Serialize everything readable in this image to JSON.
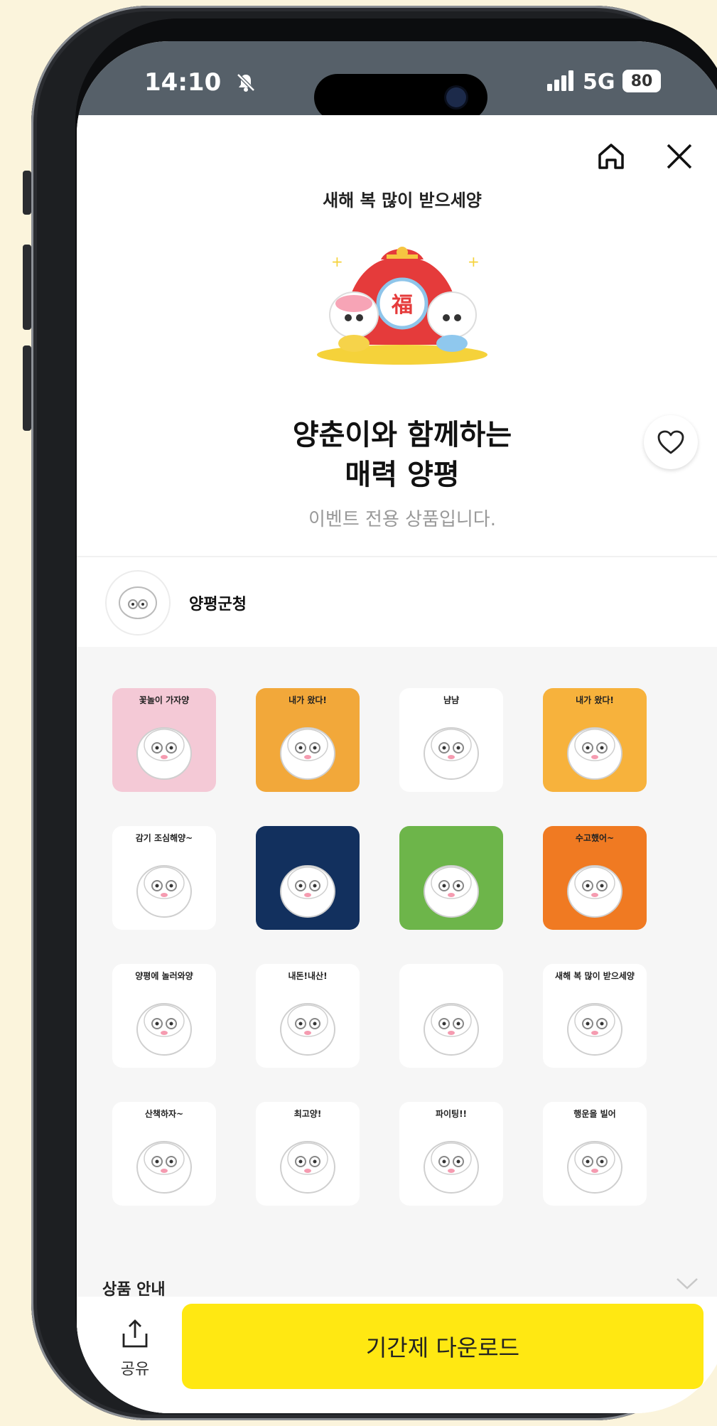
{
  "status_bar": {
    "time": "14:10",
    "network": "5G",
    "battery": "80"
  },
  "hero": {
    "label": "새해 복 많이 받으세양",
    "title_line1": "양춘이와 함께하는",
    "title_line2": "매력 양평",
    "subtitle": "이벤트 전용 상품입니다."
  },
  "author": {
    "name": "양평군청"
  },
  "stickers": [
    {
      "caption": "꽃놀이 가자양",
      "bg": "#f4c9d6"
    },
    {
      "caption": "내가 왔다!",
      "bg": "#f2a83a"
    },
    {
      "caption": "냠냠",
      "bg": "#ffffff"
    },
    {
      "caption": "내가 왔다!",
      "bg": "#f7b23c"
    },
    {
      "caption": "감기 조심해양~",
      "bg": "#ffffff"
    },
    {
      "caption": "",
      "bg": "#12305e"
    },
    {
      "caption": "",
      "bg": "#6db54a"
    },
    {
      "caption": "수고했어~",
      "bg": "#f07a22"
    },
    {
      "caption": "양평에 놀러와양",
      "bg": "#ffffff"
    },
    {
      "caption": "내돈!내산!",
      "bg": "#ffffff"
    },
    {
      "caption": "",
      "bg": "#ffffff"
    },
    {
      "caption": "새해 복 많이 받으세양",
      "bg": "#ffffff"
    },
    {
      "caption": "산책하자~",
      "bg": "#ffffff"
    },
    {
      "caption": "최고양!",
      "bg": "#ffffff"
    },
    {
      "caption": "파이팅!!",
      "bg": "#ffffff"
    },
    {
      "caption": "행운을 빌어",
      "bg": "#ffffff"
    }
  ],
  "product_info": {
    "label": "상품 안내"
  },
  "bottom_bar": {
    "share_label": "공유",
    "download_label": "기간제 다운로드"
  },
  "colors": {
    "accent": "#ffe812",
    "status_bar": "#566069",
    "page_bg": "#fbf4dc"
  }
}
